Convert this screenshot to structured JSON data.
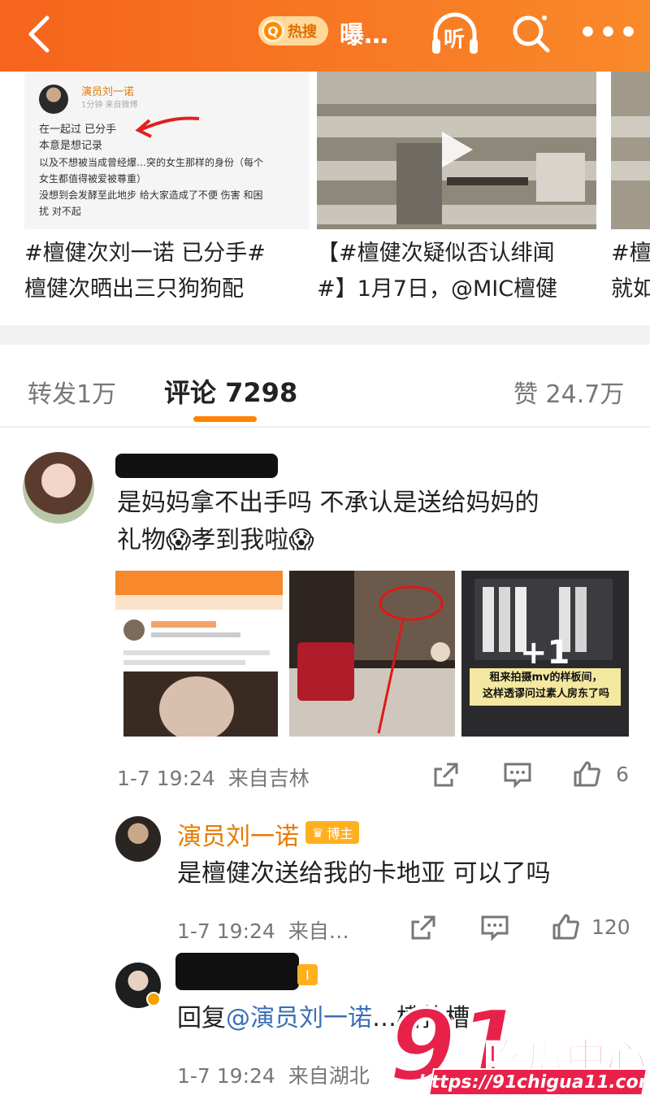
{
  "topbar": {
    "hot_label": "热搜",
    "title": "曝…",
    "listen_label": "听",
    "more_label": "•••"
  },
  "cards": [
    {
      "title_line1": "#檀健次刘一诺 已分手#",
      "title_line2": "檀健次晒出三只狗狗配",
      "post": {
        "name": "演员刘一诺",
        "meta": "1分钟 来自微博",
        "lines": [
          "在一起过 已分手",
          "本意是想记录",
          "以及不想被当成曾经爆…突的女生那样的身份（每个",
          "女生都值得被爱被尊重）",
          "没想到会发酵至此地步 给大家造成了不便 伤害 和困",
          "扰 对不起"
        ]
      }
    },
    {
      "title_line1": "【#檀健次疑似否认绯闻",
      "title_line2": "#】1月7日，@MIC檀健"
    },
    {
      "title_line1": "#檀",
      "title_line2": "就如"
    }
  ],
  "tabs": {
    "repost": "转发1万",
    "comment": "评论 7298",
    "like": "赞 24.7万"
  },
  "comment_main": {
    "text_line1": "是妈妈拿不出手吗 不承认是送给妈妈的",
    "text_line2": "礼物😱孝到我啦😱",
    "photo3_overlay": "+1",
    "photo3_caption_line1": "租来拍摄mv的样板间，",
    "photo3_caption_line2": "这样透谬问过素人房东了吗",
    "time": "1-7 19:24",
    "location": "来自吉林",
    "like_count": "6"
  },
  "reply1": {
    "name": "演员刘一诺",
    "badge": "博主",
    "text": "是檀健次送给我的卡地亚 可以了吗",
    "time": "1-7 19:24",
    "location": "来自…",
    "like_count": "120"
  },
  "reply2": {
    "badge": "I",
    "text_prefix": "回复",
    "mention": "@演员刘一诺",
    "text_suffix": "…槽扑槽",
    "time": "1-7 19:24",
    "location": "来自湖北"
  },
  "watermark": {
    "number": "91",
    "name": "吃瓜中心",
    "url": "https://91chigua11.com"
  },
  "colors": {
    "topbar": "#f6641d",
    "accent": "#ff8200",
    "mention": "#3b6fb6",
    "watermark": "#e8214a"
  },
  "icons": [
    "back-icon",
    "hot-search-icon",
    "headphones-icon",
    "search-icon",
    "more-icon",
    "share-icon",
    "comment-icon",
    "like-icon",
    "verified-icon"
  ]
}
